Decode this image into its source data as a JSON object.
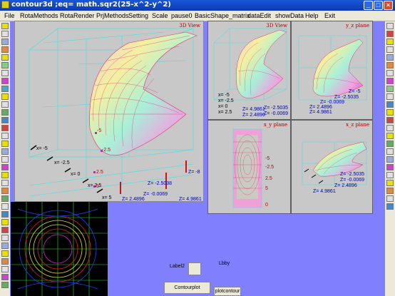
{
  "window": {
    "title": "contour3d ;eq= math.sqr2(25-x^2-y^2)"
  },
  "menu": [
    "File",
    "RotaMethods",
    "RotaRender",
    "PrjMethods",
    "Setting",
    "Scale",
    "pause0",
    "BasicShape_matrix",
    "dataEdit",
    "showData",
    "Help",
    "Exit"
  ],
  "main_view": {
    "title": "3D View",
    "labels": [
      "x= -5",
      "x= -2.5",
      "x= 0",
      "x= 2.5",
      "x= 5",
      "Z= -8",
      "Z= -2.5038",
      "Z= -0.0069",
      "Z= 2.4896",
      "Z= 4.9861",
      "-5",
      "-2.5",
      "2.5",
      "5"
    ]
  },
  "quad_views": [
    {
      "title": "3D View",
      "labels": [
        "x= -5",
        "x= -2.5",
        "x= 0",
        "x= 2.5",
        "Z= -2.5035",
        "Z= -0.0069",
        "Z= 2.4896",
        "Z= 4.9861"
      ]
    },
    {
      "title": "y_z plane",
      "labels": [
        "Z= -5",
        "Z= -2.5035",
        "Z= -0.0069",
        "Z= 2.4896",
        "Z= 4.9861"
      ]
    },
    {
      "title": "x_y plane",
      "labels": [
        "-5",
        "-2.5",
        "2.5",
        "5",
        "0"
      ]
    },
    {
      "title": "x_z plane",
      "labels": [
        "Z= -2.5035",
        "Z= -0.0069",
        "Z= 2.4896",
        "Z= 4.9861"
      ]
    }
  ],
  "controls": {
    "label2": "Label2",
    "label_by": "Lbby",
    "button_contourplot": "Contourplot",
    "button_plotcontour": "plotcontour"
  }
}
